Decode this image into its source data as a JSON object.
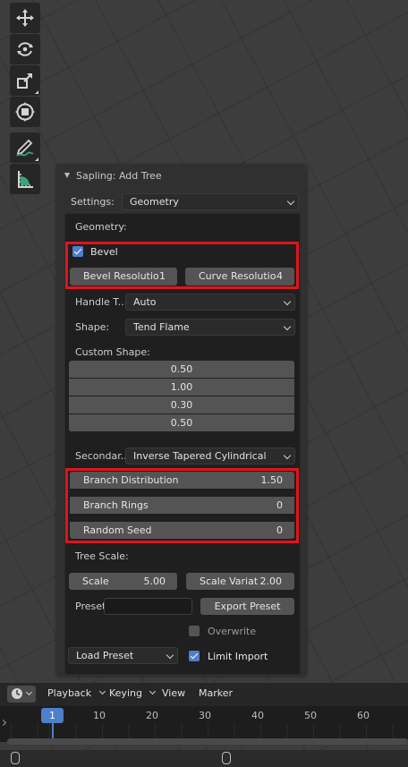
{
  "toolbar": {
    "tools": [
      "move-icon",
      "rotate-icon",
      "scale-icon",
      "transform-icon",
      "annotate-icon",
      "measure-icon"
    ]
  },
  "panel": {
    "title": "Sapling: Add Tree",
    "settings_label": "Settings:",
    "settings_value": "Geometry",
    "geometry_heading": "Geometry:",
    "bevel": {
      "label": "Bevel",
      "checked": true
    },
    "bevel_resolution": {
      "label": "Bevel Resolutio",
      "value": "1"
    },
    "curve_resolution": {
      "label": "Curve Resolutio",
      "value": "4"
    },
    "handle_type": {
      "label": "Handle T..",
      "value": "Auto"
    },
    "shape": {
      "label": "Shape:",
      "value": "Tend Flame"
    },
    "custom_shape_label": "Custom Shape:",
    "custom_shape_values": [
      "0.50",
      "1.00",
      "0.30",
      "0.50"
    ],
    "secondary": {
      "label": "Secondar..",
      "value": "Inverse Tapered Cylindrical"
    },
    "branch_distribution": {
      "label": "Branch Distribution",
      "value": "1.50"
    },
    "branch_rings": {
      "label": "Branch Rings",
      "value": "0"
    },
    "random_seed": {
      "label": "Random Seed",
      "value": "0"
    },
    "tree_scale_label": "Tree Scale:",
    "scale": {
      "label": "Scale",
      "value": "5.00"
    },
    "scale_variation": {
      "label": "Scale Variat",
      "value": "2.00"
    },
    "preset_label": "Preset",
    "preset_value": "",
    "export_preset": "Export Preset",
    "overwrite": {
      "label": "Overwrite",
      "checked": false
    },
    "load_preset": "Load Preset",
    "limit_import": {
      "label": "Limit Import",
      "checked": true
    }
  },
  "timeline": {
    "menus": [
      "Playback",
      "Keying",
      "View",
      "Marker"
    ],
    "current_frame": "1",
    "frame_labels": [
      "10",
      "20",
      "30",
      "40",
      "50",
      "60"
    ]
  },
  "colors": {
    "accent": "#4f7fc9",
    "highlight": "#e0141e",
    "panel": "#303030",
    "field": "#545454"
  }
}
